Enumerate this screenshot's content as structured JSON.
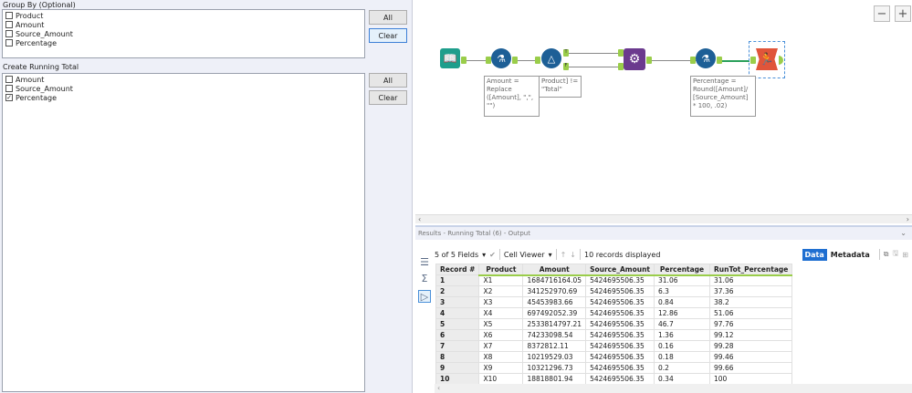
{
  "config": {
    "group_by": {
      "label": "Group By (Optional)",
      "items": [
        {
          "label": "Product",
          "checked": false
        },
        {
          "label": "Amount",
          "checked": false
        },
        {
          "label": "Source_Amount",
          "checked": false
        },
        {
          "label": "Percentage",
          "checked": false
        }
      ],
      "all_label": "All",
      "clear_label": "Clear"
    },
    "running_total": {
      "label": "Create Running Total",
      "items": [
        {
          "label": "Amount",
          "checked": false
        },
        {
          "label": "Source_Amount",
          "checked": false
        },
        {
          "label": "Percentage",
          "checked": true
        }
      ],
      "all_label": "All",
      "clear_label": "Clear"
    }
  },
  "canvas": {
    "zoom_out": "−",
    "zoom_in": "+",
    "annotations": {
      "formula1": "Amount =\nReplace\n([Amount], \",\",\n\"\")",
      "filter": "Product] !=\n\"Total\"",
      "formula2": "Percentage =\nRound([Amount]/\n[Source_Amount]\n* 100, .02)"
    },
    "anchors": {
      "true": "T",
      "false": "F"
    },
    "colors": {
      "input": "#1e9e8c",
      "formula": "#1d5f96",
      "union": "#6b3a8e",
      "output": "#e0553a"
    }
  },
  "results": {
    "title": "Results - Running Total (6) - Output",
    "fields": "5 of 5 Fields",
    "cell_viewer": "Cell Viewer",
    "records": "10 records displayed",
    "data_tab": "Data",
    "metadata_tab": "Metadata",
    "columns": [
      "Record #",
      "Product",
      "Amount",
      "Source_Amount",
      "Percentage",
      "RunTot_Percentage"
    ],
    "rows": [
      [
        "1",
        "X1",
        "1684716164.05",
        "5424695506.35",
        "31.06",
        "31.06"
      ],
      [
        "2",
        "X2",
        "341252970.69",
        "5424695506.35",
        "6.3",
        "37.36"
      ],
      [
        "3",
        "X3",
        "45453983.66",
        "5424695506.35",
        "0.84",
        "38.2"
      ],
      [
        "4",
        "X4",
        "697492052.39",
        "5424695506.35",
        "12.86",
        "51.06"
      ],
      [
        "5",
        "X5",
        "2533814797.21",
        "5424695506.35",
        "46.7",
        "97.76"
      ],
      [
        "6",
        "X6",
        "74233098.54",
        "5424695506.35",
        "1.36",
        "99.12"
      ],
      [
        "7",
        "X7",
        "8372812.11",
        "5424695506.35",
        "0.16",
        "99.28"
      ],
      [
        "8",
        "X8",
        "10219529.03",
        "5424695506.35",
        "0.18",
        "99.46"
      ],
      [
        "9",
        "X9",
        "10321296.73",
        "5424695506.35",
        "0.2",
        "99.66"
      ],
      [
        "10",
        "X10",
        "18818801.94",
        "5424695506.35",
        "0.34",
        "100"
      ]
    ]
  }
}
